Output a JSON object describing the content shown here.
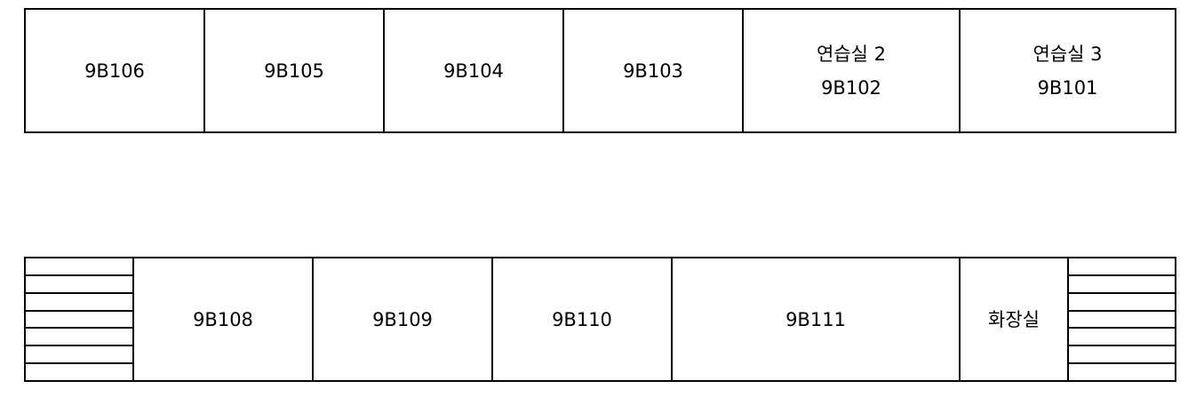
{
  "top_row": [
    {
      "lines": [
        "9B106"
      ]
    },
    {
      "lines": [
        "9B105"
      ]
    },
    {
      "lines": [
        "9B104"
      ]
    },
    {
      "lines": [
        "9B103"
      ]
    },
    {
      "lines": [
        "연습실 2",
        "9B102"
      ]
    },
    {
      "lines": [
        "연습실 3",
        "9B101"
      ]
    }
  ],
  "bottom_row": {
    "rooms": [
      {
        "lines": [
          "9B108"
        ]
      },
      {
        "lines": [
          "9B109"
        ]
      },
      {
        "lines": [
          "9B110"
        ]
      },
      {
        "lines": [
          "9B111"
        ]
      },
      {
        "lines": [
          "화장실"
        ]
      }
    ],
    "stair_steps": 7
  }
}
